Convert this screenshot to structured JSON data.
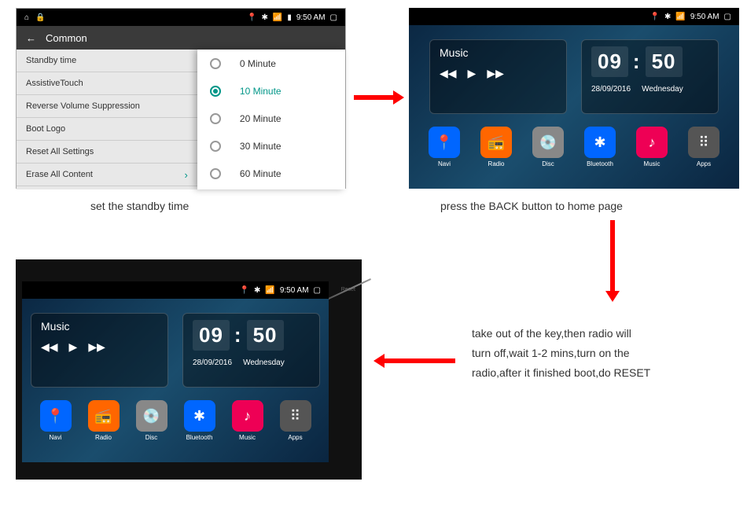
{
  "status": {
    "time": "9:50 AM",
    "android": "▢"
  },
  "panel1": {
    "back": "←",
    "title": "Common",
    "list": [
      "Standby time",
      "AssistiveTouch",
      "Reverse Volume Suppression",
      "Boot Logo",
      "Reset All Settings",
      "Erase All Content"
    ],
    "popup": [
      {
        "label": "0 Minute",
        "selected": false
      },
      {
        "label": "10 Minute",
        "selected": true
      },
      {
        "label": "20 Minute",
        "selected": false
      },
      {
        "label": "30 Minute",
        "selected": false
      },
      {
        "label": "60 Minute",
        "selected": false
      }
    ]
  },
  "home": {
    "music": {
      "title": "Music",
      "prev": "◀◀",
      "play": "▶",
      "next": "▶▶"
    },
    "clock": {
      "hour": "09",
      "sep": ":",
      "min": "50",
      "date": "28/09/2016",
      "day": "Wednesday"
    },
    "apps": [
      {
        "label": "Navi",
        "color": "#0066ff",
        "glyph": "📍"
      },
      {
        "label": "Radio",
        "color": "#ff6600",
        "glyph": "📻"
      },
      {
        "label": "Disc",
        "color": "#888888",
        "glyph": "💿"
      },
      {
        "label": "Bluetooth",
        "color": "#0066ff",
        "glyph": "✱"
      },
      {
        "label": "Music",
        "color": "#ee0055",
        "glyph": "♪"
      },
      {
        "label": "Apps",
        "color": "#555555",
        "glyph": "⠿"
      }
    ]
  },
  "panel3": {
    "reset": "Reset"
  },
  "captions": {
    "c1": "set the standby time",
    "c2": "press the BACK button to home page",
    "c3a": "take out of the key,then radio will",
    "c3b": "turn off,wait 1-2 mins,turn on the",
    "c3c": "radio,after it finished boot,do RESET"
  }
}
